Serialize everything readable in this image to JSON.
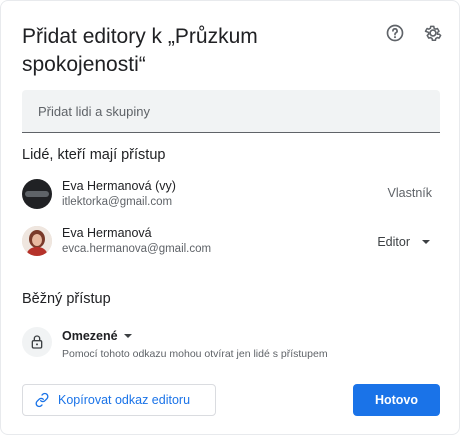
{
  "dialog": {
    "title": "Přidat editory k „Průzkum spokojenosti“"
  },
  "header": {
    "icons": [
      "help-icon",
      "settings-icon"
    ]
  },
  "add_people": {
    "placeholder": "Přidat lidi a skupiny"
  },
  "people_section": {
    "title": "Lidé, kteří mají přístup",
    "people": [
      {
        "name": "Eva Hermanová (vy)",
        "email": "itlektorka@gmail.com",
        "role": "Vlastník"
      },
      {
        "name": "Eva Hermanová",
        "email": "evca.hermanova@gmail.com",
        "role": "Editor"
      }
    ]
  },
  "general_access": {
    "title": "Běžný přístup",
    "level": "Omezené",
    "description": "Pomocí tohoto odkazu mohou otvírat jen lidé s přístupem"
  },
  "footer": {
    "copy_label": "Kopírovat odkaz editoru",
    "done_label": "Hotovo"
  },
  "colors": {
    "accent": "#1a73e8",
    "field_bg": "#f1f3f4",
    "text_primary": "#202124",
    "text_secondary": "#5f6368"
  }
}
